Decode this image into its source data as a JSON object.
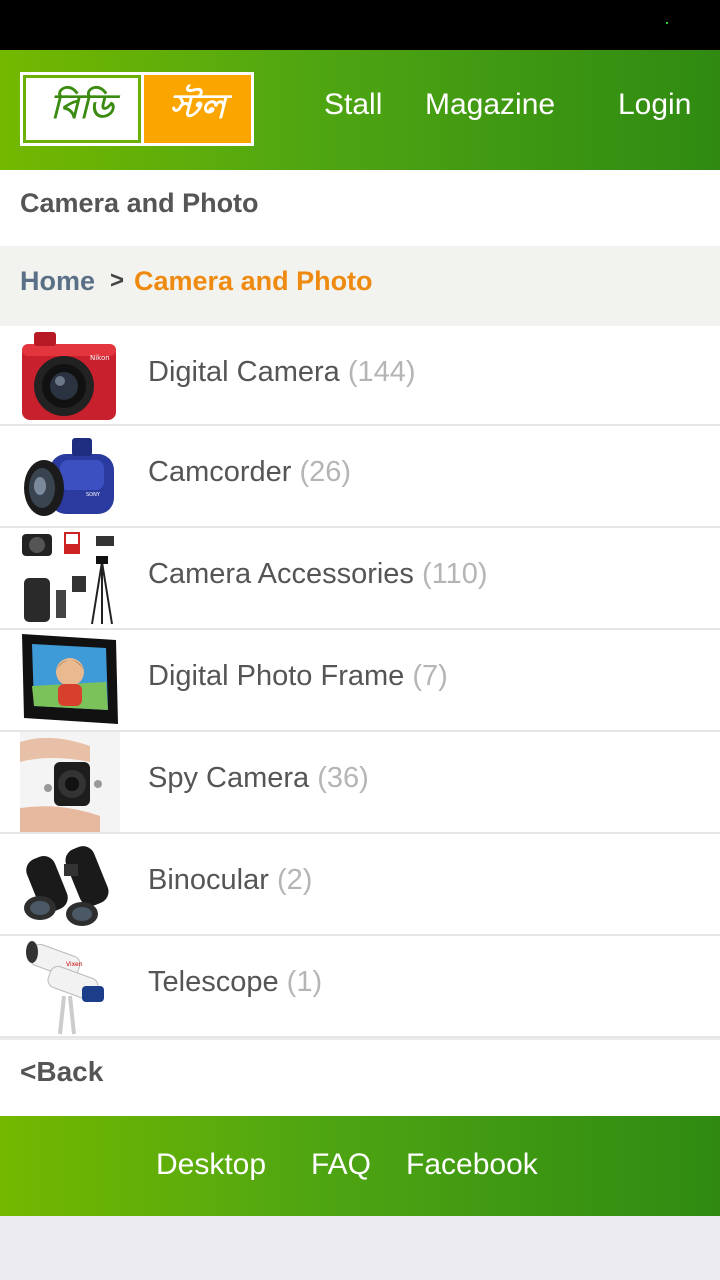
{
  "header": {
    "logo_left": "বিডি",
    "logo_right": "স্টল",
    "nav": [
      "Stall",
      "Magazine",
      "Login"
    ]
  },
  "page_title": "Camera and Photo",
  "breadcrumb": {
    "home": "Home",
    "separator": ">",
    "current": "Camera and Photo"
  },
  "categories": [
    {
      "label": "Digital Camera",
      "count": "(144)",
      "icon": "digital-camera-image"
    },
    {
      "label": "Camcorder",
      "count": "(26)",
      "icon": "camcorder-image"
    },
    {
      "label": "Camera Accessories",
      "count": "(110)",
      "icon": "camera-accessories-image"
    },
    {
      "label": "Digital Photo Frame",
      "count": "(7)",
      "icon": "photo-frame-image"
    },
    {
      "label": "Spy Camera",
      "count": "(36)",
      "icon": "spy-camera-image"
    },
    {
      "label": "Binocular",
      "count": "(2)",
      "icon": "binocular-image"
    },
    {
      "label": "Telescope",
      "count": "(1)",
      "icon": "telescope-image"
    }
  ],
  "back_label": "<Back",
  "footer": {
    "links": [
      "Desktop",
      "FAQ",
      "Facebook"
    ]
  },
  "colors": {
    "header_green": "#4ea512",
    "accent_orange": "#ef8a10",
    "logo_orange": "#fba600"
  }
}
